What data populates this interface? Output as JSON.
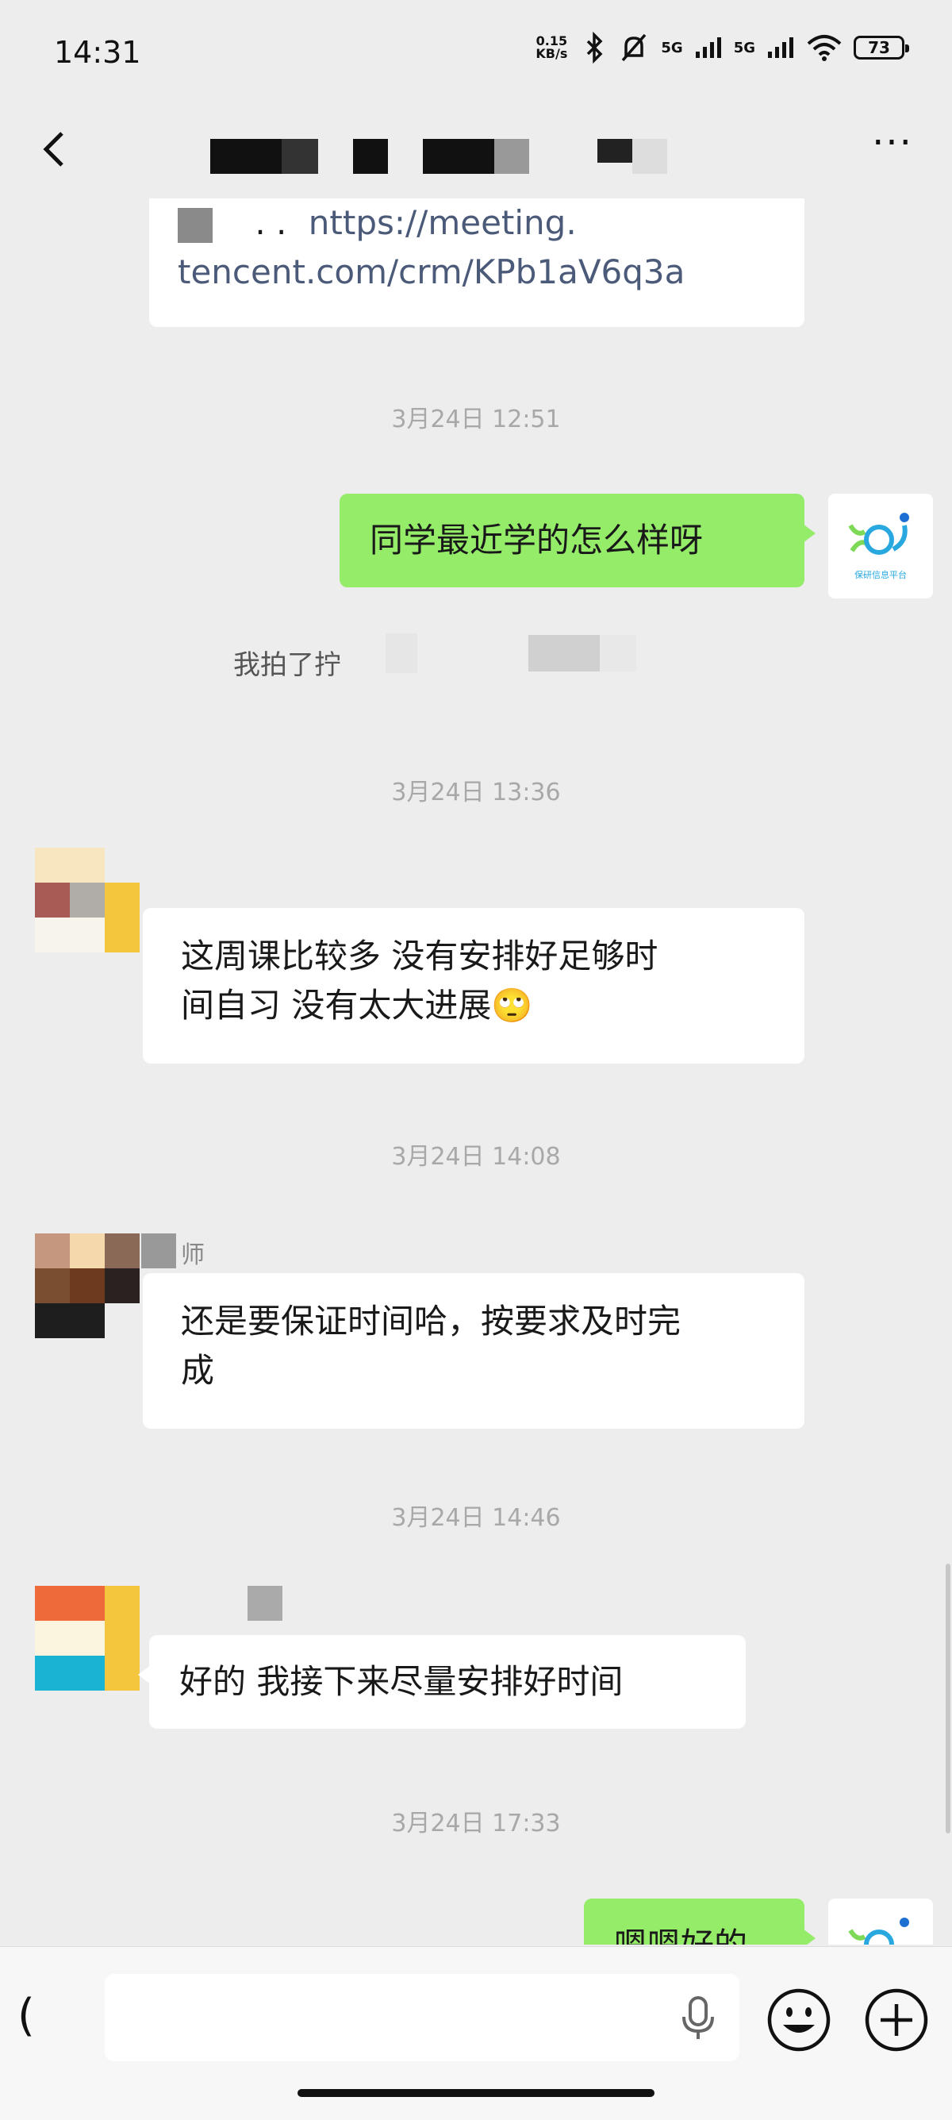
{
  "status_bar": {
    "time": "14:31",
    "speed": "0.15\nKB/s",
    "net_label_1": "5G",
    "net_label_2": "5G",
    "battery": "73"
  },
  "nav": {
    "back_icon": "chevron-left-icon",
    "more_icon": "more-dots-icon",
    "more_label": "···"
  },
  "chat": {
    "msg_link": {
      "prefix": ". .",
      "line1": "nttps://meeting.",
      "line2": "tencent.com/crm/KPb1aV6q3a"
    },
    "time_1": "3月24日 12:51",
    "msg_1": "同学最近学的怎么样呀",
    "system_1": "我拍了拧",
    "time_2": "3月24日 13:36",
    "msg_2_line1": "这周课比较多 没有安排好足够时",
    "msg_2_line2": "间自习 没有太大进展",
    "msg_2_emoji": "🙄",
    "time_3": "3月24日 14:08",
    "sender_3_name": "师",
    "msg_3_line1": "还是要保证时间哈，按要求及时完",
    "msg_3_line2": "成",
    "time_4": "3月24日 14:46",
    "msg_4": "好的 我接下来尽量安排好时间",
    "time_5": "3月24日 17:33",
    "msg_5": "嗯嗯好的",
    "logo_caption": "保研信息平台"
  },
  "input_bar": {
    "voice_icon": "voice-toggle-icon",
    "voice_label": "(",
    "placeholder": "",
    "mic_icon": "microphone-icon",
    "emoji_icon": "emoji-icon",
    "plus_icon": "plus-icon"
  },
  "colors": {
    "background": "#ededed",
    "green_bubble": "#95ec69",
    "white_bubble": "#ffffff",
    "timestamp": "#a8a8a8",
    "link": "#4b5a78"
  }
}
